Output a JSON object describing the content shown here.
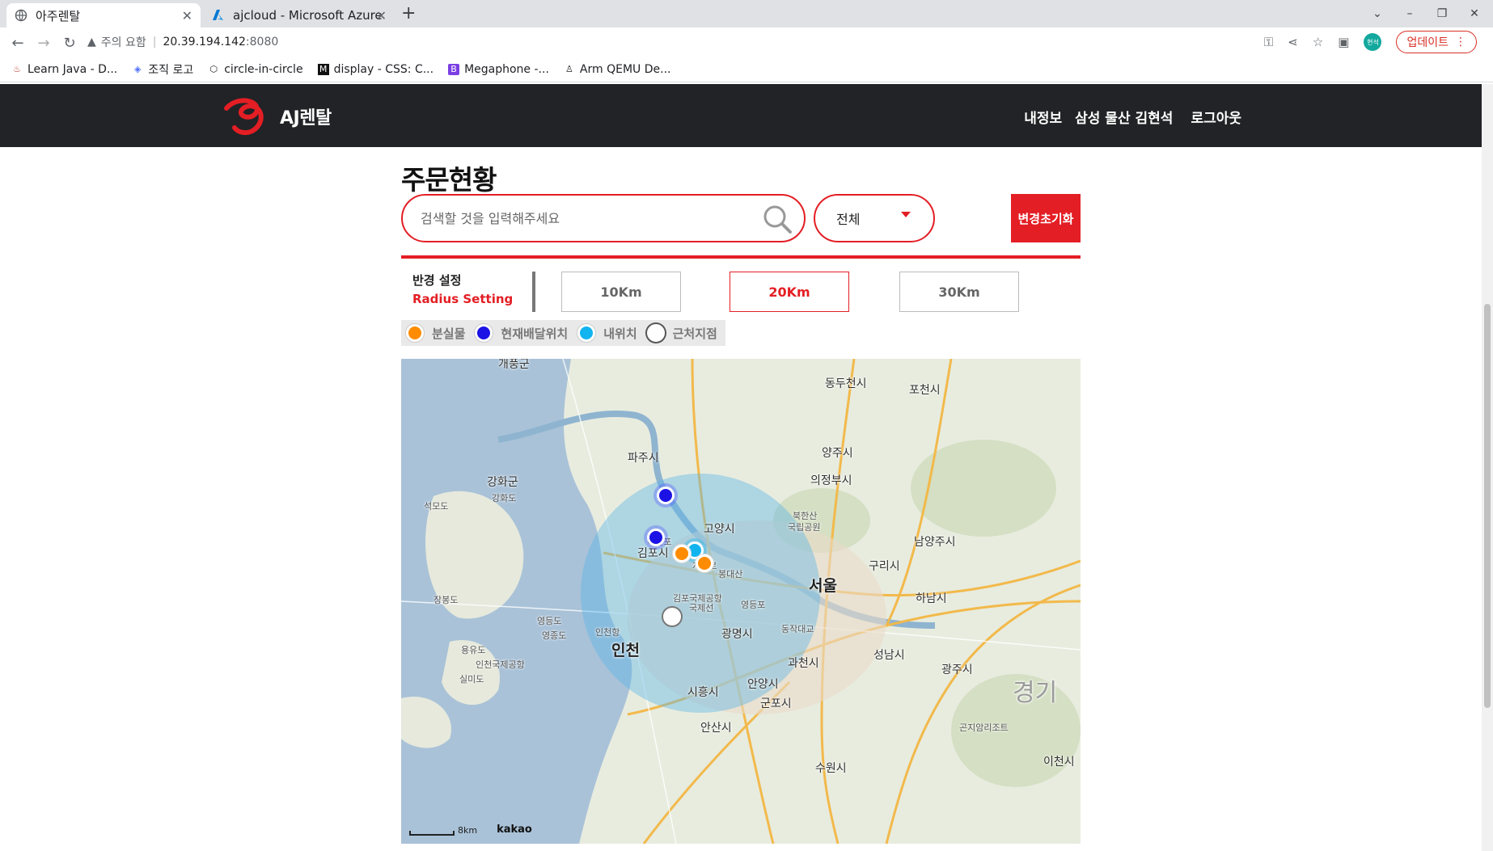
{
  "browser": {
    "tabs": [
      {
        "title": "아주렌탈",
        "active": true
      },
      {
        "title": "ajcloud - Microsoft Azure",
        "active": false
      }
    ],
    "url": {
      "warning": "주의 요함",
      "host": "20.39.194.142",
      "port": ":8080"
    },
    "update_label": "업데이트",
    "profile_label": "현석",
    "bookmarks": [
      "Learn Java - D...",
      "조직 로고",
      "circle-in-circle",
      "display - CSS: C...",
      "Megaphone -...",
      "Arm QEMU De..."
    ]
  },
  "site": {
    "brand": "AJ렌탈",
    "nav": [
      "내정보",
      "삼성 물산 김현석",
      "로그아웃"
    ],
    "brand_color": "#e31e24"
  },
  "orders": {
    "title": "주문현황",
    "search_placeholder": "검색할 것을 입력해주세요",
    "filter_value": "전체",
    "reset_label": "변경초기화",
    "radius": {
      "label_ko": "반경 설정",
      "label_en": "Radius Setting",
      "options": [
        "10Km",
        "20Km",
        "30Km"
      ],
      "selected": "20Km"
    },
    "legend": [
      {
        "label": "분실물",
        "color": "#ff8c00"
      },
      {
        "label": "현재배달위치",
        "color": "#1c12e6"
      },
      {
        "label": "내위치",
        "color": "#12b4f0"
      },
      {
        "label": "근처지점",
        "color": "#ffffff"
      }
    ]
  },
  "map": {
    "labels": [
      "개풍군",
      "동두천시",
      "포천시",
      "파주시",
      "양주시",
      "강화군",
      "강화도",
      "의정부시",
      "석모도",
      "고양시",
      "북한산",
      "국립공원",
      "김포시",
      "이산포",
      "자유로",
      "봉대산",
      "남양주시",
      "구리시",
      "서울",
      "장봉도",
      "김포국제공항",
      "국제선",
      "영등도",
      "영종도",
      "인천항",
      "광명시",
      "하남시",
      "인천",
      "용유도",
      "인천국제공항",
      "실미도",
      "과천시",
      "성남시",
      "광주시",
      "안양시",
      "시흥시",
      "군포시",
      "안산시",
      "곤지암리조트",
      "경기",
      "이천시",
      "수원시",
      "동작대교",
      "영등포"
    ],
    "scale": "8km",
    "provider": "kakao",
    "markers": [
      {
        "type": "현재배달위치",
        "color": "#1c12e6"
      },
      {
        "type": "현재배달위치",
        "color": "#1c12e6"
      },
      {
        "type": "분실물",
        "color": "#ff8c00"
      },
      {
        "type": "분실물",
        "color": "#ff8c00"
      },
      {
        "type": "내위치",
        "color": "#12b4f0"
      },
      {
        "type": "근처지점",
        "color": "#ffffff"
      }
    ]
  }
}
